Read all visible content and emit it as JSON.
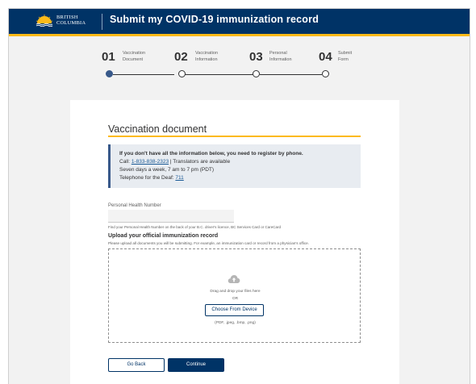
{
  "header": {
    "logo_line1": "BRITISH",
    "logo_line2": "COLUMBIA",
    "title": "Submit my COVID-19 immunization record",
    "background": "#003366",
    "accent": "#fcba19"
  },
  "stepper": {
    "current": 1,
    "steps": [
      {
        "number": "01",
        "label_line1": "Vaccination",
        "label_line2": "Document"
      },
      {
        "number": "02",
        "label_line1": "Vaccination",
        "label_line2": "Information"
      },
      {
        "number": "03",
        "label_line1": "Personal",
        "label_line2": "Information"
      },
      {
        "number": "04",
        "label_line1": "Submit",
        "label_line2": "Form"
      }
    ]
  },
  "form": {
    "section_title": "Vaccination document",
    "callout": {
      "heading": "If you don't have all the information below, you need to register by phone.",
      "call_prefix": "Call: ",
      "phone": "1-833-838-2323",
      "call_suffix": " | Translators are available",
      "hours": "Seven days a week, 7 am to 7 pm (PDT)",
      "deaf_prefix": "Telephone for the Deaf: ",
      "deaf_number": "711"
    },
    "phn": {
      "label": "Personal Health Number",
      "value": "",
      "help": "Find your Personal Health Number on the back of your B.C. driver's licence, BC Services Card or CareCard"
    },
    "upload": {
      "title": "Upload your official immunization record",
      "help": "Please upload all documents you will be submitting. For example, an immunization card or record from a physician's office.",
      "icon": "cloud-upload-icon",
      "drag_text": "Drag and drop your files here",
      "or_text": "OR",
      "choose_label": "Choose From Device",
      "formats": "(PDF, .jpeg, .bmp, .png)"
    },
    "buttons": {
      "back_label": "Go Back",
      "continue_label": "Continue"
    }
  }
}
